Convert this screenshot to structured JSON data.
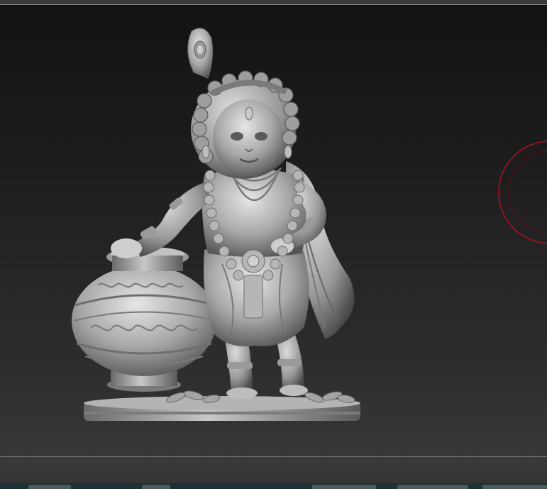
{
  "viewport": {
    "subject": "sculpt-model",
    "background_top": "#121212",
    "background_bottom": "#3a3a3a"
  },
  "brush_cursor": {
    "icon": "brush-cursor-icon",
    "color": "#b01020"
  },
  "status_bar": {
    "color": "#1d3236"
  }
}
